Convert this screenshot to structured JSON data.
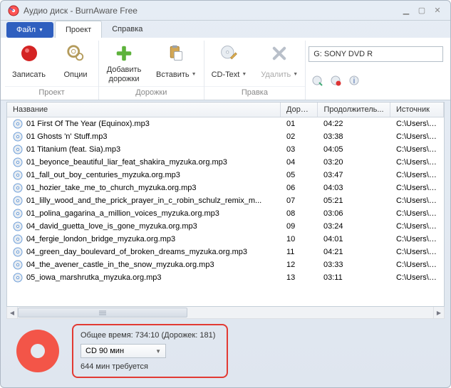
{
  "window": {
    "title": "Аудио диск - BurnAware Free"
  },
  "menu": {
    "file": "Файл",
    "project": "Проект",
    "help": "Справка"
  },
  "ribbon": {
    "burn": "Записать",
    "options": "Опции",
    "add_tracks": "Добавить\nдорожки",
    "insert": "Вставить",
    "cdtext": "CD-Text",
    "delete": "Удалить",
    "group_project": "Проект",
    "group_tracks": "Дорожки",
    "group_edit": "Правка",
    "drive": "G: SONY DVD R"
  },
  "columns": {
    "name": "Название",
    "track": "Доро...",
    "duration": "Продолжитель...",
    "source": "Источник"
  },
  "rows": [
    {
      "name": "01 First Of The Year (Equinox).mp3",
      "track": "01",
      "duration": "04:22",
      "source": "C:\\Users\\kate\\Mus"
    },
    {
      "name": "01 Ghosts 'n' Stuff.mp3",
      "track": "02",
      "duration": "03:38",
      "source": "C:\\Users\\kate\\Mus"
    },
    {
      "name": "01 Titanium (feat. Sia).mp3",
      "track": "03",
      "duration": "04:05",
      "source": "C:\\Users\\kate\\Mus"
    },
    {
      "name": "01_beyonce_beautiful_liar_feat_shakira_myzuka.org.mp3",
      "track": "04",
      "duration": "03:20",
      "source": "C:\\Users\\kate\\Mus"
    },
    {
      "name": "01_fall_out_boy_centuries_myzuka.org.mp3",
      "track": "05",
      "duration": "03:47",
      "source": "C:\\Users\\kate\\Mus"
    },
    {
      "name": "01_hozier_take_me_to_church_myzuka.org.mp3",
      "track": "06",
      "duration": "04:03",
      "source": "C:\\Users\\kate\\Mus"
    },
    {
      "name": "01_lilly_wood_and_the_prick_prayer_in_c_robin_schulz_remix_m...",
      "track": "07",
      "duration": "05:21",
      "source": "C:\\Users\\kate\\Mus"
    },
    {
      "name": "01_polina_gagarina_a_million_voices_myzuka.org.mp3",
      "track": "08",
      "duration": "03:06",
      "source": "C:\\Users\\kate\\Mus"
    },
    {
      "name": "04_david_guetta_love_is_gone_myzuka.org.mp3",
      "track": "09",
      "duration": "03:24",
      "source": "C:\\Users\\kate\\Mus"
    },
    {
      "name": "04_fergie_london_bridge_myzuka.org.mp3",
      "track": "10",
      "duration": "04:01",
      "source": "C:\\Users\\kate\\Mus"
    },
    {
      "name": "04_green_day_boulevard_of_broken_dreams_myzuka.org.mp3",
      "track": "11",
      "duration": "04:21",
      "source": "C:\\Users\\kate\\Mus"
    },
    {
      "name": "04_the_avener_castle_in_the_snow_myzuka.org.mp3",
      "track": "12",
      "duration": "03:33",
      "source": "C:\\Users\\kate\\Mus"
    },
    {
      "name": "05_iowa_marshrutka_myzuka.org.mp3",
      "track": "13",
      "duration": "03:11",
      "source": "C:\\Users\\kate\\Mus"
    }
  ],
  "summary": {
    "total": "Общее время: 734:10 (Дорожек: 181)",
    "disc_type": "CD 90 мин",
    "required": "644 мин требуется"
  }
}
